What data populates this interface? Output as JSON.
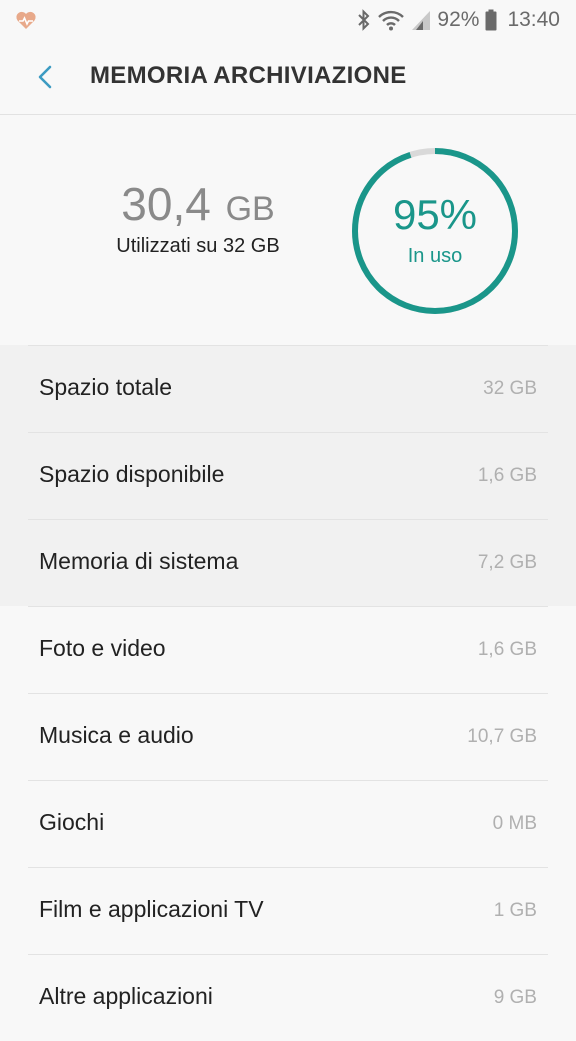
{
  "status_bar": {
    "battery_percent": "92%",
    "time": "13:40",
    "icons": [
      "health-icon",
      "bluetooth-icon",
      "wifi-icon",
      "cell-signal-icon",
      "battery-icon"
    ]
  },
  "header": {
    "title": "MEMORIA ARCHIVIAZIONE",
    "back_icon": "chevron-left-icon"
  },
  "summary": {
    "used_value": "30,4",
    "used_unit": "GB",
    "used_caption": "Utilizzati su 32 GB",
    "percent_text": "95%",
    "percent_fraction": 0.95,
    "percent_caption": "In uso"
  },
  "colors": {
    "accent": "#1a968a",
    "ring_track": "#d9d9d9",
    "back_icon": "#3c9bc2"
  },
  "items": [
    {
      "label": "Spazio totale",
      "value": "32 GB",
      "shaded": true
    },
    {
      "label": "Spazio disponibile",
      "value": "1,6 GB",
      "shaded": true
    },
    {
      "label": "Memoria di sistema",
      "value": "7,2 GB",
      "shaded": true
    },
    {
      "label": "Foto e video",
      "value": "1,6 GB",
      "shaded": false
    },
    {
      "label": "Musica e audio",
      "value": "10,7 GB",
      "shaded": false
    },
    {
      "label": "Giochi",
      "value": "0 MB",
      "shaded": false
    },
    {
      "label": "Film e applicazioni TV",
      "value": "1 GB",
      "shaded": false
    },
    {
      "label": "Altre applicazioni",
      "value": "9 GB",
      "shaded": false
    }
  ]
}
